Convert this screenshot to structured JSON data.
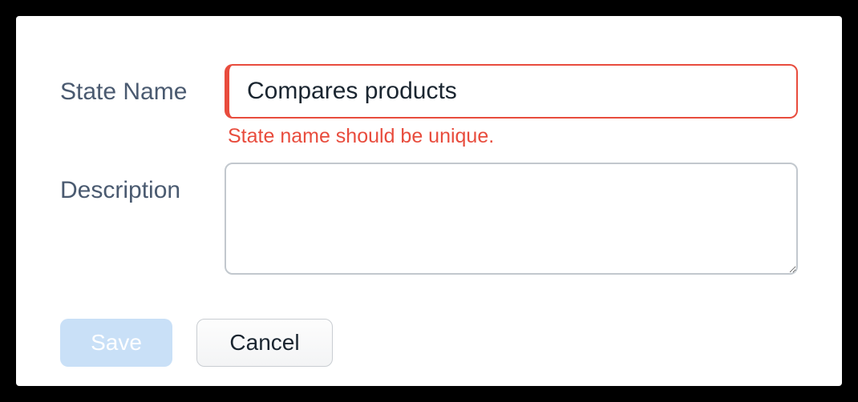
{
  "form": {
    "state_name": {
      "label": "State Name",
      "value": "Compares products",
      "error": "State name should be unique."
    },
    "description": {
      "label": "Description",
      "value": ""
    }
  },
  "buttons": {
    "save": "Save",
    "cancel": "Cancel"
  }
}
